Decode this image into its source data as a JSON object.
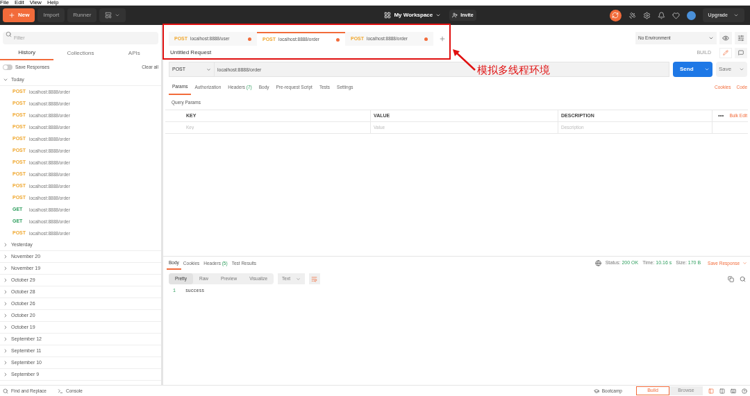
{
  "menu_bar": [
    "File",
    "Edit",
    "View",
    "Help"
  ],
  "header": {
    "new_button": "New",
    "buttons": [
      "Import",
      "Runner"
    ],
    "workspace": "My Workspace",
    "invite": "Invite",
    "upgrade": "Upgrade"
  },
  "sidebar": {
    "filter_placeholder": "Filter",
    "tabs": [
      {
        "label": "History",
        "selected": true
      },
      {
        "label": "Collections",
        "selected": false
      },
      {
        "label": "APIs",
        "selected": false
      }
    ],
    "save_responses": {
      "label": "Save Responses",
      "on": false
    },
    "clear_all": "Clear all",
    "groups": [
      {
        "label": "Today",
        "expanded": true,
        "children": [
          {
            "method": "POST",
            "color": "#f0a830",
            "url": "localhost:8888/order"
          },
          {
            "method": "POST",
            "color": "#f0a830",
            "url": "localhost:8888/order"
          },
          {
            "method": "POST",
            "color": "#f0a830",
            "url": "localhost:8888/order"
          },
          {
            "method": "POST",
            "color": "#f0a830",
            "url": "localhost:8888/order"
          },
          {
            "method": "POST",
            "color": "#f0a830",
            "url": "localhost:8888/order"
          },
          {
            "method": "POST",
            "color": "#f0a830",
            "url": "localhost:8888/order"
          },
          {
            "method": "POST",
            "color": "#f0a830",
            "url": "localhost:8888/order"
          },
          {
            "method": "POST",
            "color": "#f0a830",
            "url": "localhost:8888/order"
          },
          {
            "method": "POST",
            "color": "#f0a830",
            "url": "localhost:8888/order"
          },
          {
            "method": "POST",
            "color": "#f0a830",
            "url": "localhost:8888/order"
          },
          {
            "method": "GET",
            "color": "#2e9e5e",
            "url": "localhost:8888/order"
          },
          {
            "method": "GET",
            "color": "#2e9e5e",
            "url": "localhost:8888/order"
          },
          {
            "method": "POST",
            "color": "#f0a830",
            "url": "localhost:8888/order"
          }
        ]
      },
      {
        "label": "Yesterday",
        "expanded": false
      },
      {
        "label": "November 20",
        "expanded": false
      },
      {
        "label": "November 19",
        "expanded": false
      },
      {
        "label": "October 29",
        "expanded": false
      },
      {
        "label": "October 28",
        "expanded": false
      },
      {
        "label": "October 26",
        "expanded": false
      },
      {
        "label": "October 20",
        "expanded": false
      },
      {
        "label": "October 19",
        "expanded": false
      },
      {
        "label": "September 12",
        "expanded": false
      },
      {
        "label": "September 11",
        "expanded": false
      },
      {
        "label": "September 10",
        "expanded": false
      },
      {
        "label": "September 9",
        "expanded": false
      }
    ]
  },
  "request_tabs": [
    {
      "method": "POST",
      "url": "localhost:8888/user",
      "selected": false,
      "unsaved": true
    },
    {
      "method": "POST",
      "url": "localhost:8888/order",
      "selected": true,
      "unsaved": true
    },
    {
      "method": "POST",
      "url": "localhost:8888/order",
      "selected": false,
      "unsaved": true
    }
  ],
  "environment": "No Environment",
  "request_name": "Untitled Request",
  "mode": "BUILD",
  "url_bar": {
    "method": "POST",
    "url": "localhost:8888/order",
    "send": "Send",
    "save": "Save"
  },
  "request_subtabs": [
    {
      "label": "Params",
      "selected": true
    },
    {
      "label": "Authorization",
      "selected": false
    },
    {
      "label": "Headers",
      "count": "(7)",
      "selected": false
    },
    {
      "label": "Body",
      "selected": false
    },
    {
      "label": "Pre-request Script",
      "selected": false
    },
    {
      "label": "Tests",
      "selected": false
    },
    {
      "label": "Settings",
      "selected": false
    }
  ],
  "links": [
    "Cookies",
    "Code"
  ],
  "query_params": {
    "title": "Query Params",
    "columns": [
      "KEY",
      "VALUE",
      "DESCRIPTION"
    ],
    "more": "•••",
    "bulk_edit": "Bulk Edit",
    "placeholders": [
      "Key",
      "Value",
      "Description"
    ]
  },
  "response": {
    "tabs": [
      {
        "label": "Body",
        "selected": true
      },
      {
        "label": "Cookies",
        "selected": false
      },
      {
        "label": "Headers",
        "count": "(5)",
        "selected": false
      },
      {
        "label": "Test Results",
        "selected": false
      }
    ],
    "stats": [
      {
        "label": "Status:",
        "value": "200 OK"
      },
      {
        "label": "Time:",
        "value": "10.16 s"
      },
      {
        "label": "Size:",
        "value": "170 B"
      }
    ],
    "save_response": "Save Response",
    "view_modes": [
      {
        "label": "Pretty",
        "selected": true
      },
      {
        "label": "Raw",
        "selected": false
      },
      {
        "label": "Preview",
        "selected": false
      },
      {
        "label": "Visualize",
        "selected": false
      }
    ],
    "format": "Text",
    "lines": [
      {
        "number": "1",
        "text": "success"
      }
    ]
  },
  "status_bar": {
    "find_replace": "Find and Replace",
    "console": "Console",
    "bootcamp": "Bootcamp",
    "modes": [
      {
        "label": "Build",
        "selected": true
      },
      {
        "label": "Browse",
        "selected": false
      }
    ]
  },
  "annotation": {
    "text": "模拟多线程环境"
  }
}
